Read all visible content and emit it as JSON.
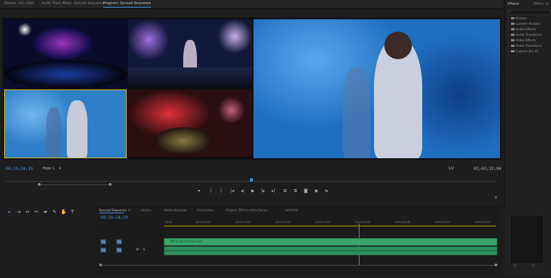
{
  "top_tabs": {
    "source": "Source: (no clips)",
    "audio_mixer": "Audio Track Mixer: Synced Sequence",
    "program": "Program: Synced Sequence",
    "program_menu": "≡"
  },
  "program_monitor": {
    "timecode_left": "00;10;24;29",
    "page_label": "Page 1",
    "page_dropdown": "▾",
    "fit": "1/2",
    "timecode_right": "02;03;32;04"
  },
  "transport": {
    "mark_in": "▾",
    "mark_out": "|",
    "clear": "|",
    "goto_in": "|◂",
    "step_back": "◂|",
    "play": "▶",
    "step_fwd": "|▸",
    "goto_out": "▸|",
    "lift": "⧉",
    "extract": "⧉",
    "export_frame": "◙",
    "mc_record": "◉",
    "mc_toggle": "⇆",
    "add": "+"
  },
  "effects_panel": {
    "tab_effects": "Effects",
    "tab_effect_controls": "Effect",
    "menu": "≡",
    "search_icon": "⌕",
    "items": [
      "Presets",
      "Lumetri Presets",
      "Audio Effects",
      "Audio Transitions",
      "Video Effects",
      "Video Transitions",
      "Custom Bin 01"
    ]
  },
  "timeline": {
    "tabs": [
      "Synced Sequence",
      "Library",
      "Media Browser",
      "Production",
      "Project: Effects Intro Demo",
      "Info/Info"
    ],
    "active_tab_close": "≡",
    "timecode": "00;10;24;29",
    "ruler": [
      "00;00",
      "00;01;00;00",
      "00;01;14;24",
      "00;01;34;24",
      "00;02;13;22",
      "00;10;48;16",
      "00;12;48;48",
      "00;14;00;01",
      "00;15;00;04"
    ],
    "track_v1": "V1",
    "track_a1": "A1",
    "track_v1_target": "V1",
    "track_a1_target": "A1",
    "clip_name": "[MC1] Synced Seq.mov",
    "mute": "M",
    "solo": "S"
  },
  "tools": [
    "▸",
    "⇥",
    "⇔",
    "✂",
    "⬌",
    "✎",
    "✋",
    "T"
  ],
  "meter": {
    "label_l": "S",
    "label_r": "S"
  },
  "colors": {
    "accent": "#4a90d9",
    "clip_video": "#3aa66a",
    "clip_audio": "#2f8f5d",
    "active_cam": "#e0c000"
  }
}
